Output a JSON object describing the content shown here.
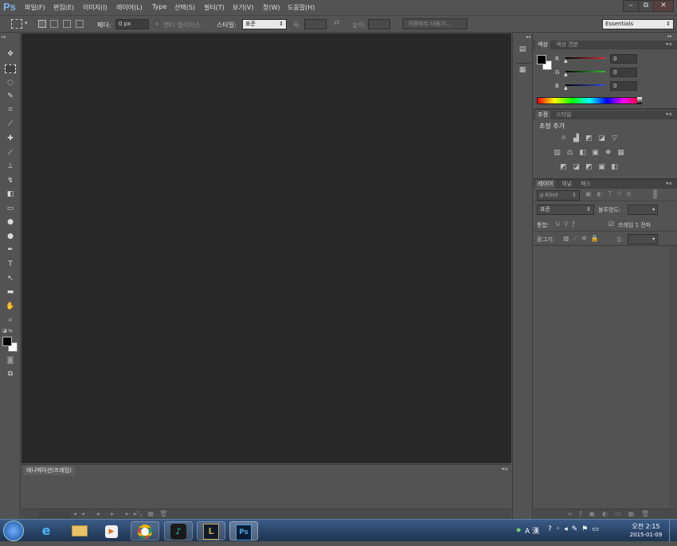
{
  "menubar": {
    "logo": "Ps",
    "items": [
      "파일(F)",
      "편집(E)",
      "이미지(I)",
      "레이어(L)",
      "Type",
      "선택(S)",
      "필터(T)",
      "보기(V)",
      "창(W)",
      "도움말(H)"
    ],
    "window_buttons": [
      "‒",
      "⧉",
      "✕"
    ]
  },
  "options": {
    "feather_label": "페더:",
    "feather_value": "0 px",
    "antialias_label": "앤티 앨리어스",
    "style_label": "스타일:",
    "style_value": "표준",
    "width_label": "폭:",
    "height_label": "높이:",
    "refine_edge_button": "가장자리 다듬기...",
    "workspace_value": "Essentials"
  },
  "tools": [
    "move-tool",
    "marquee-tool",
    "lasso-tool",
    "quick-select-tool",
    "crop-tool",
    "eyedropper-tool",
    "spot-healing-tool",
    "brush-tool",
    "clone-stamp-tool",
    "history-brush-tool",
    "eraser-tool",
    "gradient-tool",
    "blur-tool",
    "dodge-tool",
    "pen-tool",
    "type-tool",
    "path-select-tool",
    "rectangle-tool",
    "hand-tool",
    "zoom-tool"
  ],
  "animation_panel": {
    "tab_label": "애니메이션(프레임)"
  },
  "color_panel": {
    "tabs": [
      "색상",
      "색상 견본"
    ],
    "channels": [
      {
        "label": "R",
        "value": "0",
        "color": "#e03030"
      },
      {
        "label": "G",
        "value": "0",
        "color": "#30c030"
      },
      {
        "label": "B",
        "value": "0",
        "color": "#3050e0"
      }
    ]
  },
  "adjustments_panel": {
    "tabs": [
      "조정",
      "스타일"
    ],
    "heading": "조정 추가"
  },
  "layers_panel": {
    "tabs": [
      "레이어",
      "채널",
      "패스"
    ],
    "kind_filter": "ρ Kind",
    "blend_mode": "표준",
    "opacity_label": "불투명도:",
    "unify_label": "통합:",
    "propagate_label": "프레임 1 전파",
    "lock_label": "잠그기:",
    "fill_label": "칠:"
  },
  "taskbar": {
    "apps": [
      "ie-icon",
      "explorer-icon",
      "media-player-icon",
      "chrome-icon",
      "music-app-icon",
      "league-icon",
      "photoshop-icon"
    ],
    "photoshop_label": "Ps",
    "tray_ime": "A 漢",
    "clock_time": "오전 2:15",
    "clock_date": "2015-01-09"
  }
}
